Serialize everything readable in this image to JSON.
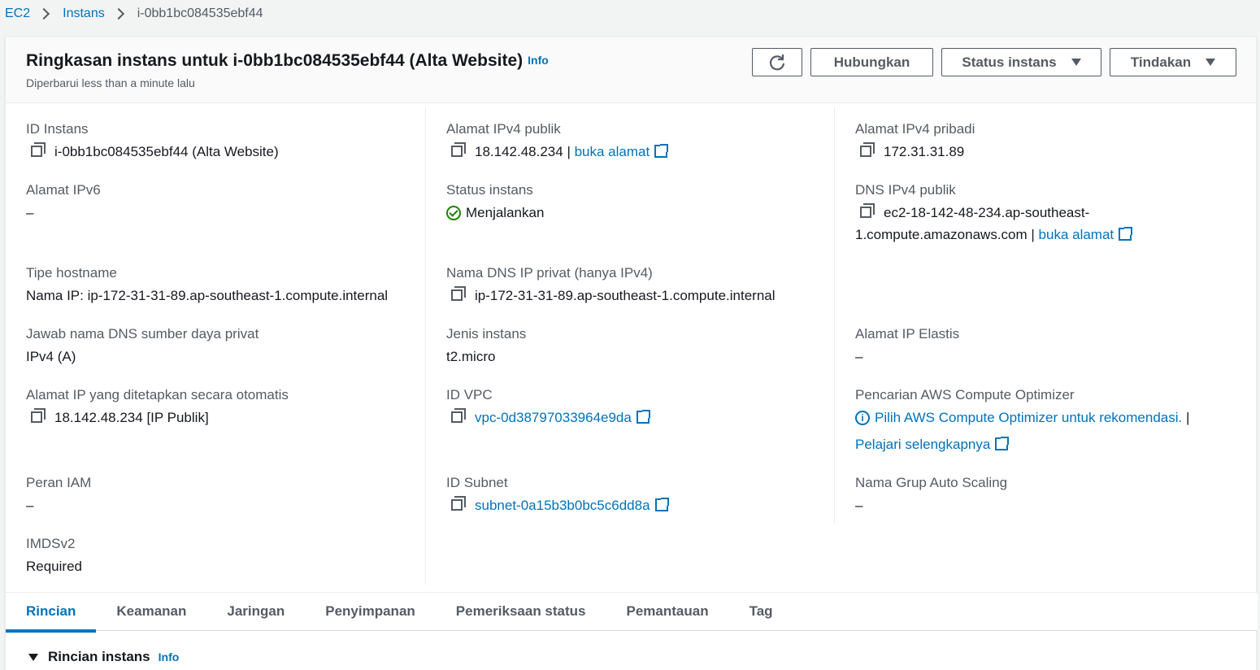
{
  "breadcrumb": {
    "root": "EC2",
    "section": "Instans",
    "current": "i-0bb1bc084535ebf44"
  },
  "header": {
    "title": "Ringkasan instans untuk i-0bb1bc084535ebf44 (Alta Website)",
    "info": "Info",
    "subtitle": "Diperbarui less than a minute lalu",
    "buttons": {
      "connect": "Hubungkan",
      "status": "Status instans",
      "actions": "Tindakan"
    }
  },
  "fields": {
    "instance_id": {
      "label": "ID Instans",
      "value": "i-0bb1bc084535ebf44 (Alta Website)"
    },
    "ipv6": {
      "label": "Alamat IPv6",
      "value": "–"
    },
    "hostname_type": {
      "label": "Tipe hostname",
      "value": "Nama IP: ip-172-31-31-89.ap-southeast-1.compute.internal"
    },
    "dns_answer": {
      "label": "Jawab nama DNS sumber daya privat",
      "value": "IPv4 (A)"
    },
    "auto_ip": {
      "label": "Alamat IP yang ditetapkan secara otomatis",
      "value": "18.142.48.234 [IP Publik]"
    },
    "iam_role": {
      "label": "Peran IAM",
      "value": "–"
    },
    "imds": {
      "label": "IMDSv2",
      "value": "Required"
    },
    "public_ipv4": {
      "label": "Alamat IPv4 publik",
      "value": "18.142.48.234 |",
      "link": "buka alamat"
    },
    "instance_state": {
      "label": "Status instans",
      "value": "Menjalankan"
    },
    "private_dns": {
      "label": "Nama DNS IP privat (hanya IPv4)",
      "value": "ip-172-31-31-89.ap-southeast-1.compute.internal"
    },
    "instance_type": {
      "label": "Jenis instans",
      "value": "t2.micro"
    },
    "vpc_id": {
      "label": "ID VPC",
      "value": "vpc-0d38797033964e9da"
    },
    "subnet_id": {
      "label": "ID Subnet",
      "value": "subnet-0a15b3b0bc5c6dd8a"
    },
    "private_ipv4": {
      "label": "Alamat IPv4 pribadi",
      "value": "172.31.31.89"
    },
    "public_dns": {
      "label": "DNS IPv4 publik",
      "value_line1": "ec2-18-142-48-234.ap-southeast-",
      "value_line2": "1.compute.amazonaws.com |",
      "link": "buka alamat"
    },
    "elastic_ip": {
      "label": "Alamat IP Elastis",
      "value": "–"
    },
    "optimizer": {
      "label": "Pencarian AWS Compute Optimizer",
      "link": "Pilih AWS Compute Optimizer untuk rekomendasi.",
      "sep": "|",
      "learn": "Pelajari selengkapnya"
    },
    "asg": {
      "label": "Nama Grup Auto Scaling",
      "value": "–"
    }
  },
  "tabs": [
    "Rincian",
    "Keamanan",
    "Jaringan",
    "Penyimpanan",
    "Pemeriksaan status",
    "Pemantauan",
    "Tag"
  ],
  "section": {
    "title": "Rincian instans",
    "info": "Info"
  },
  "colors": {
    "link": "#0073bb",
    "success": "#1d8102",
    "text": "#16191f",
    "muted": "#545b64"
  }
}
